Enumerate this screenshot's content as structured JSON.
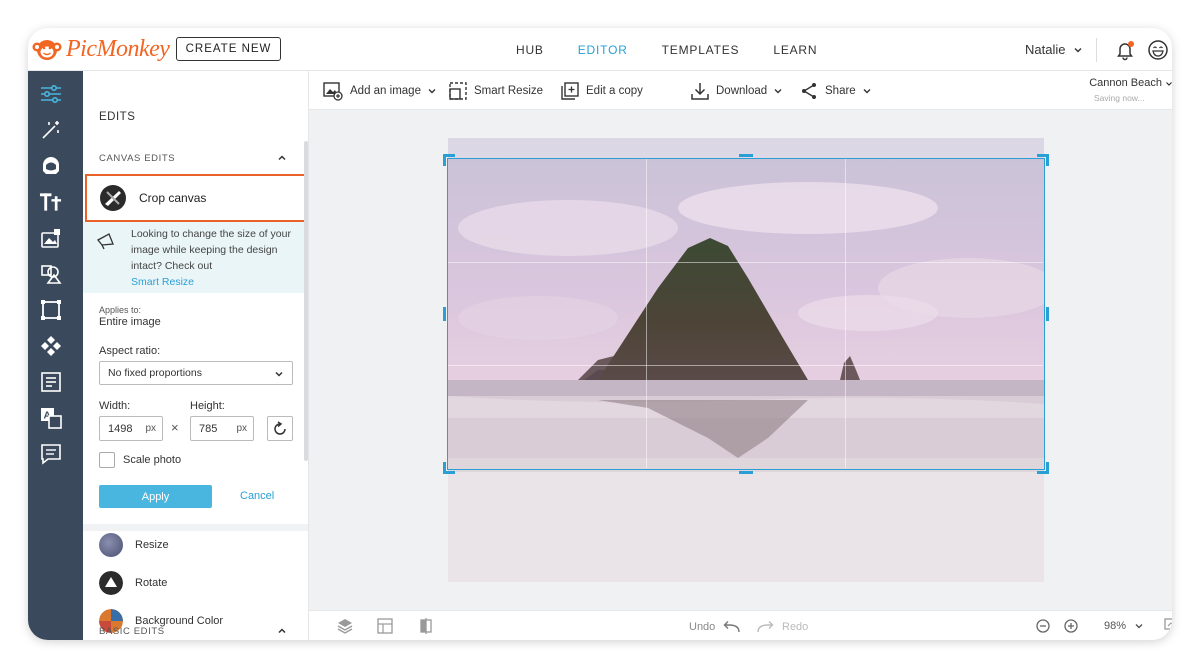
{
  "header": {
    "logo_text": "PicMonkey",
    "create_new": "CREATE NEW",
    "nav": [
      "HUB",
      "EDITOR",
      "TEMPLATES",
      "LEARN"
    ],
    "active_nav": "EDITOR",
    "user_name": "Natalie",
    "notification_dot_color": "#f26522"
  },
  "rail": {
    "icons": [
      "sliders-icon",
      "magic-wand-icon",
      "face-icon",
      "text-icon",
      "image-add-icon",
      "shapes-icon",
      "frame-icon",
      "texture-icon",
      "layout-icon",
      "translate-icon",
      "comment-icon"
    ]
  },
  "panel": {
    "title": "EDITS",
    "section_canvas": "CANVAS EDITS",
    "crop_label": "Crop canvas",
    "tip_text": "Looking to change the size of your image while keeping the design intact? Check out",
    "tip_link": "Smart Resize",
    "applies_label": "Applies to:",
    "applies_value": "Entire image",
    "aspect_label": "Aspect ratio:",
    "aspect_value": "No fixed proportions",
    "width_label": "Width:",
    "height_label": "Height:",
    "width_value": "1498",
    "height_value": "785",
    "unit": "px",
    "times": "×",
    "scale_label": "Scale photo",
    "apply": "Apply",
    "cancel": "Cancel",
    "tools": [
      "Resize",
      "Rotate",
      "Background Color"
    ],
    "section_basic": "BASIC EDITS"
  },
  "toolbar": {
    "add_image": "Add an image",
    "smart_resize": "Smart Resize",
    "edit_copy": "Edit a copy",
    "download": "Download",
    "share": "Share",
    "project_name": "Cannon Beach",
    "saving": "Saving now..."
  },
  "bottombar": {
    "undo": "Undo",
    "redo": "Redo",
    "zoom": "98%"
  },
  "colors": {
    "accent": "#2a9fd6",
    "brand": "#f26522",
    "highlight_border": "#e8622a",
    "apply_button": "#49b6df",
    "rail_bg": "#3a4a5c"
  }
}
